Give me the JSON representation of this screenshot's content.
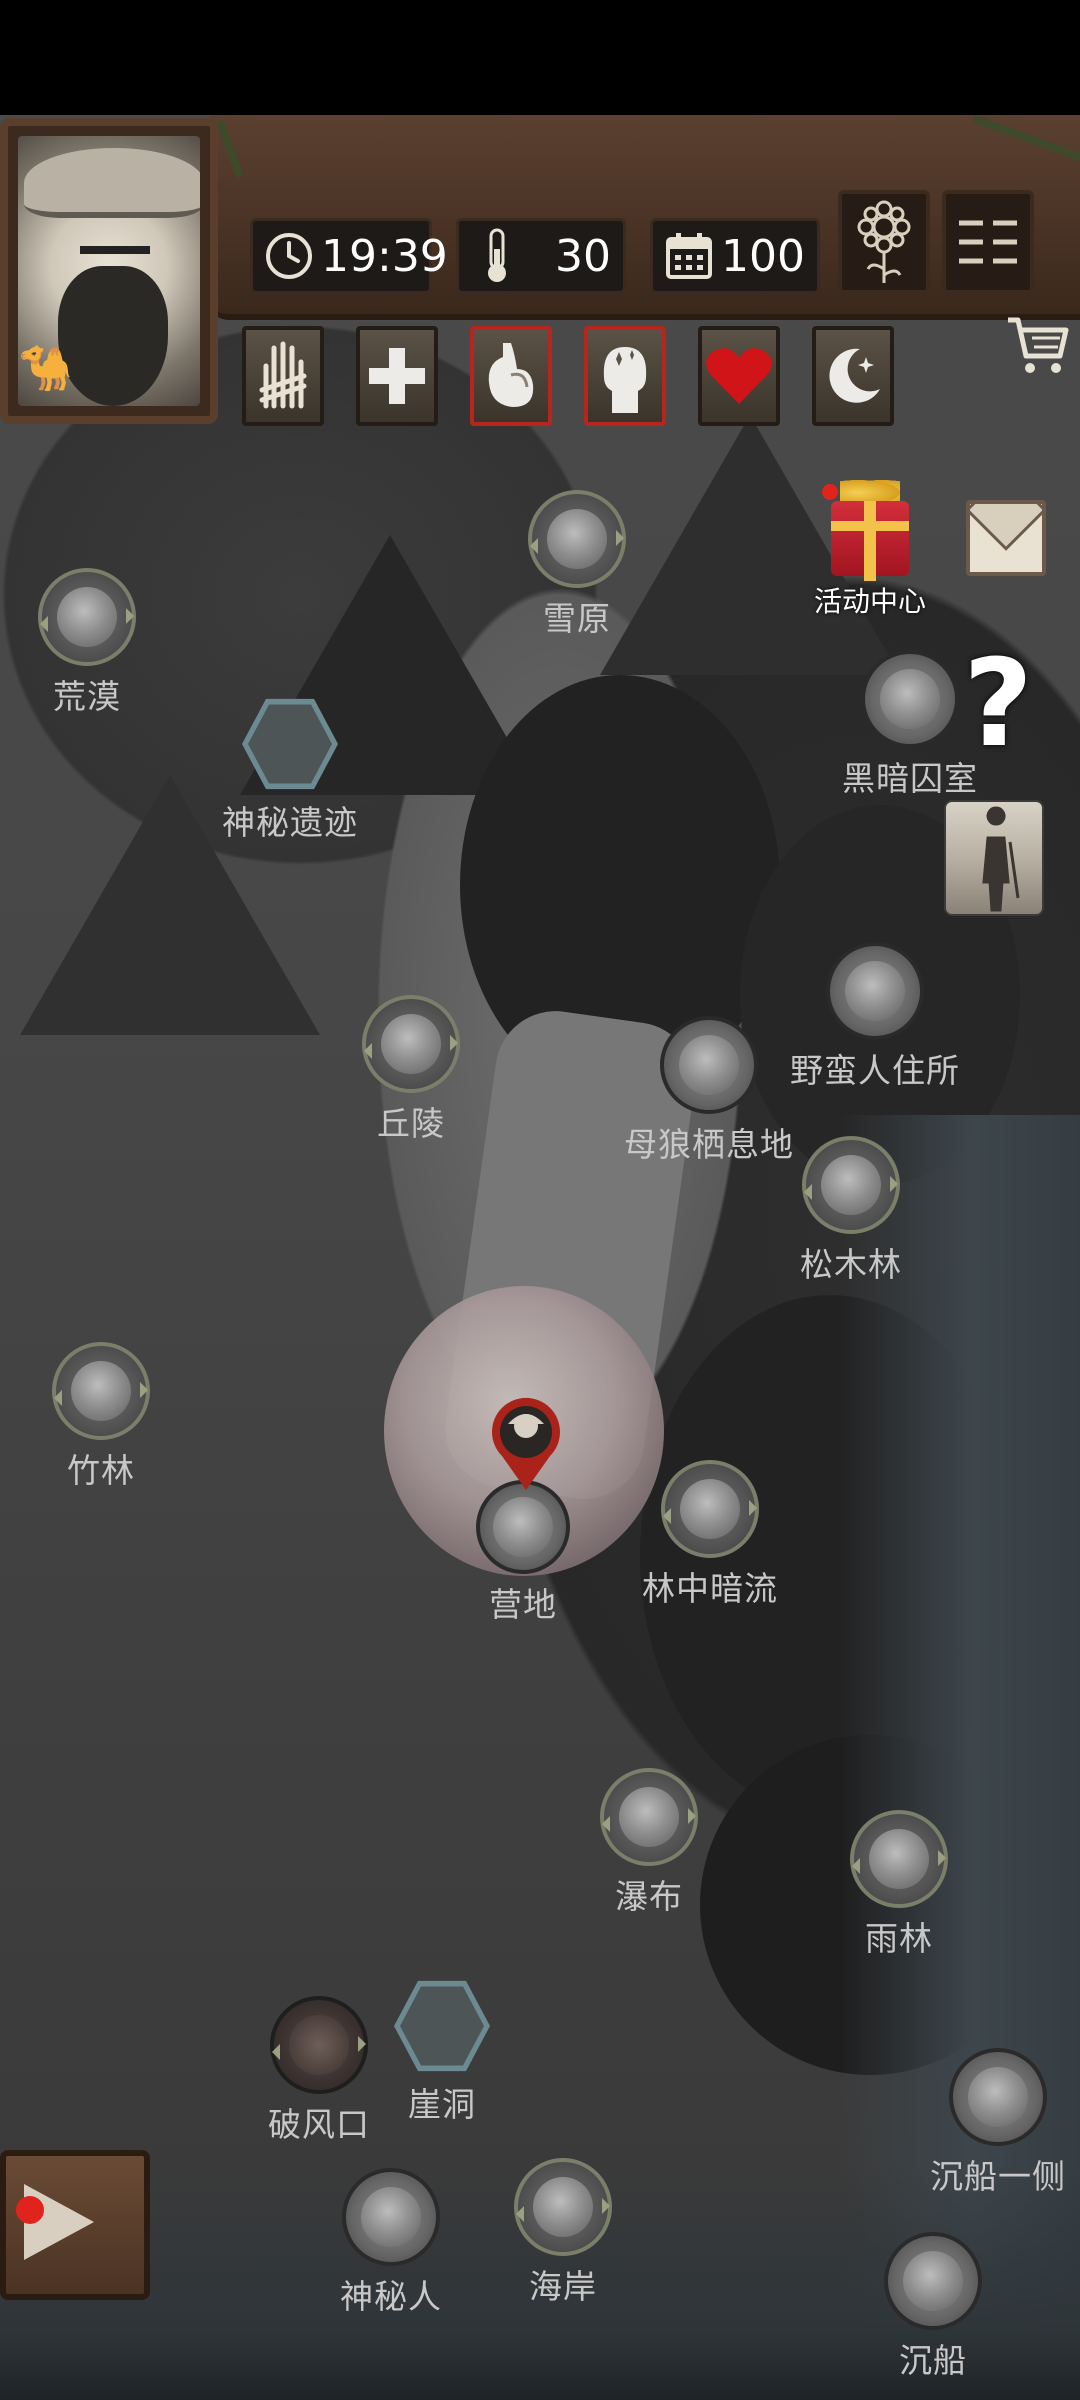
{
  "hud": {
    "time": "19:39",
    "temperature": "30",
    "days": "100"
  },
  "attributes": [
    {
      "name": "hand-injury",
      "alert": false
    },
    {
      "name": "health",
      "alert": false
    },
    {
      "name": "stomach",
      "alert": true
    },
    {
      "name": "mind",
      "alert": true
    },
    {
      "name": "heart",
      "alert": false
    },
    {
      "name": "sleep",
      "alert": false
    }
  ],
  "side": {
    "gift_label": "活动中心"
  },
  "locations": {
    "desert": "荒漠",
    "snowfield": "雪原",
    "ruins": "神秘遗迹",
    "prison": "黑暗囚室",
    "hills": "丘陵",
    "savage": "野蛮人住所",
    "wolf_den": "母狼栖息地",
    "pine": "松木林",
    "bamboo": "竹林",
    "camp": "营地",
    "creek": "林中暗流",
    "waterfall": "瀑布",
    "rainforest": "雨林",
    "windgap": "破风口",
    "cave": "崖洞",
    "shipwreck_side": "沉船一侧",
    "mystery": "神秘人",
    "coast": "海岸",
    "shipwreck": "沉船"
  },
  "colors": {
    "alert_border": "#b7261d",
    "badge_red": "#e1231d",
    "wood": "#4a3325"
  }
}
